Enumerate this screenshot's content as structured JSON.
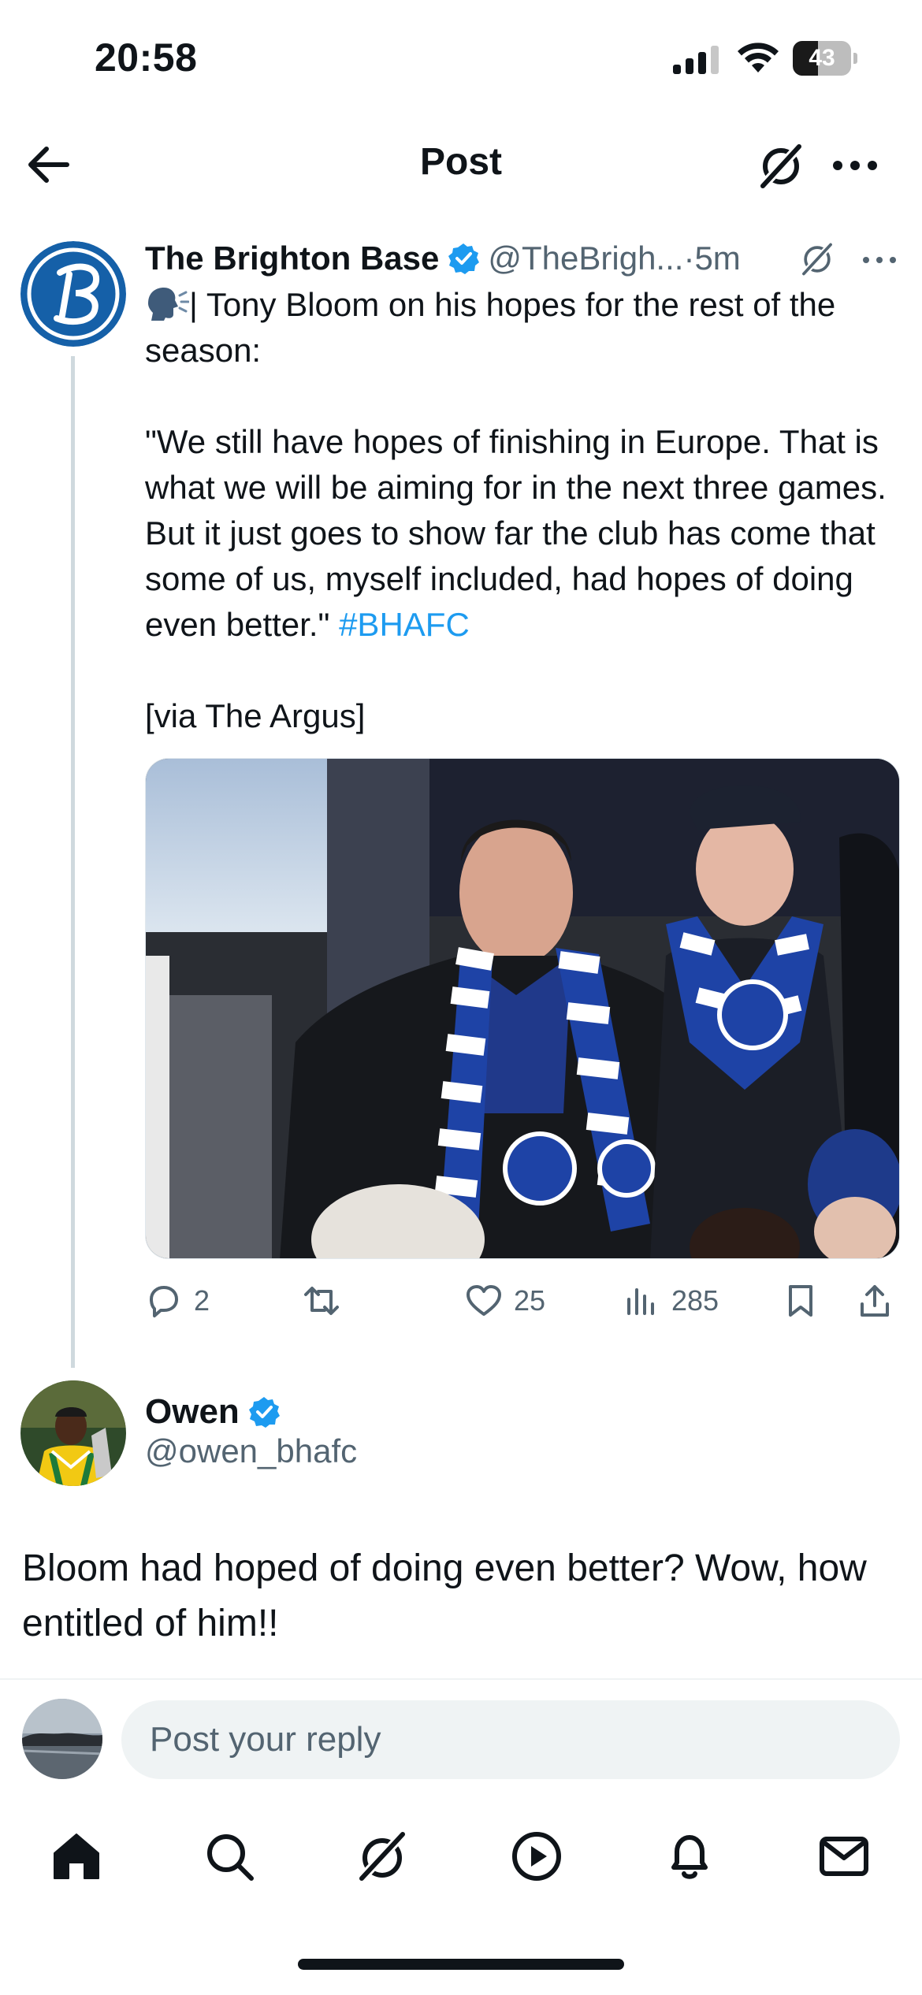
{
  "status_bar": {
    "time": "20:58",
    "battery_level": "43",
    "battery_fraction": 0.43
  },
  "header": {
    "title": "Post",
    "back_icon": "arrow-left-icon",
    "grok_icon": "grok-icon",
    "more_icon": "more-horizontal-icon"
  },
  "parent_post": {
    "author_name": "The Brighton Base",
    "handle": "@TheBrigh...",
    "separator": " · ",
    "time": "5m",
    "text_lead": "| Tony Bloom on his hopes for the rest of the season:",
    "quote": "\"We still have hopes of finishing in Europe. That is what we will be aiming for in the next three games. But it just goes to show far the club has come that some of us, myself included, had hopes of doing even better.\" ",
    "hashtag": "#BHAFC",
    "via": "[via The Argus]",
    "stats": {
      "replies": "2",
      "reposts": "",
      "likes": "25",
      "views": "285"
    }
  },
  "focused_post": {
    "author_name": "Owen",
    "handle": "@owen_bhafc",
    "text": "Bloom had hoped of doing even better? Wow, how entitled of him!!"
  },
  "composer": {
    "placeholder": "Post your reply"
  },
  "nav": {
    "items": [
      "home-icon",
      "search-icon",
      "grok-icon",
      "video-icon",
      "notifications-icon",
      "messages-icon"
    ],
    "active": "home-icon"
  },
  "colors": {
    "text_primary": "#0f1419",
    "text_secondary": "#536471",
    "accent": "#1d9bf0",
    "divider": "#eff3f4",
    "brighton_blue": "#1560a8"
  }
}
